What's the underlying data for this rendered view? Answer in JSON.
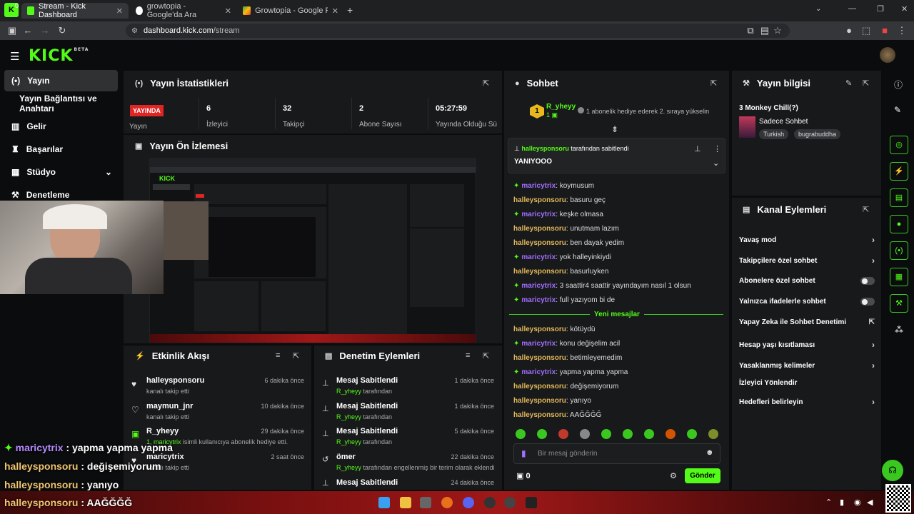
{
  "browser": {
    "tabs": [
      {
        "title": "Stream - Kick Dashboard",
        "active": true
      },
      {
        "title": "growtopia - Google'da Ara",
        "active": false
      },
      {
        "title": "Growtopia - Google Play'de Uy:",
        "active": false
      }
    ],
    "url_host": "dashboard.kick.com",
    "url_path": "/stream",
    "corner_badge": "0"
  },
  "logo": "KICK",
  "logo_beta": "BETA",
  "sidebar": {
    "items": [
      {
        "label": "Yayın",
        "icon": "broadcast-icon"
      },
      {
        "label": "Yayın Bağlantısı ve Anahtarı",
        "icon": ""
      },
      {
        "label": "Gelir",
        "icon": "chart-icon"
      },
      {
        "label": "Başarılar",
        "icon": "trophy-icon"
      },
      {
        "label": "Stüdyo",
        "icon": "studio-icon"
      },
      {
        "label": "Denetleme",
        "icon": "gavel-icon"
      }
    ]
  },
  "stats": {
    "title": "Yayın İstatistikleri",
    "live_badge": "YAYINDA",
    "status_label": "Yayın",
    "items": [
      {
        "value": "6",
        "label": "İzleyici"
      },
      {
        "value": "32",
        "label": "Takipçi"
      },
      {
        "value": "2",
        "label": "Abone Sayısı"
      },
      {
        "value": "05:27:59",
        "label": "Yayında Olduğu Sü"
      }
    ]
  },
  "preview": {
    "title": "Yayın Ön İzlemesi"
  },
  "activity": {
    "title": "Etkinlik Akışı",
    "rows": [
      {
        "name": "halleysponsoru",
        "sub": "kanalı takip etti",
        "time": "6 dakika önce"
      },
      {
        "name": "maymun_jnr",
        "sub": "kanalı takip etti",
        "time": "10 dakika önce"
      },
      {
        "name": "R_yheyy",
        "sub_user": "1, maricytrix",
        "sub": "isimli kullanıcıya abonelik hediye etti.",
        "time": "29 dakika önce"
      },
      {
        "name": "maricytrix",
        "sub": "kanalı takip etti",
        "time": "2 saat önce"
      }
    ]
  },
  "moderation": {
    "title": "Denetim Eylemleri",
    "rows": [
      {
        "name": "Mesaj Sabitlendi",
        "user": "R_yheyy",
        "sub": "tarafından",
        "time": "1 dakika önce"
      },
      {
        "name": "Mesaj Sabitlendi",
        "user": "R_yheyy",
        "sub": "tarafından",
        "time": "1 dakika önce"
      },
      {
        "name": "Mesaj Sabitlendi",
        "user": "R_yheyy",
        "sub": "tarafından",
        "time": "5 dakika önce"
      },
      {
        "name": "ömer",
        "user": "R_yheyy",
        "sub": "tarafından engellenmiş bir terim olarak eklendi",
        "time": "22 dakika önce"
      },
      {
        "name": "Mesaj Sabitlendi",
        "user": "",
        "sub": "",
        "time": "24 dakika önce"
      }
    ]
  },
  "chat": {
    "title": "Sohbet",
    "gifter_rank": "1",
    "gifter_name": "R_yheyy",
    "gifter_count": "1",
    "gift_notice": "1 abonelik hediye ederek 2. sıraya yükselin",
    "pinned_by_user": "halleysponsoru",
    "pinned_by_suffix": "tarafından sabitlendi",
    "pinned_text": "YANIYOOO",
    "new_messages": "Yeni mesajlar",
    "messages_before": [
      {
        "user": "maricytrix",
        "text": "koymusum",
        "type": "sub"
      },
      {
        "user": "halleysponsoru",
        "text": "basuru geç",
        "type": "norm"
      },
      {
        "user": "maricytrix",
        "text": "keşke olmasa",
        "type": "sub"
      },
      {
        "user": "halleysponsoru",
        "text": "unutmam lazım",
        "type": "norm"
      },
      {
        "user": "halleysponsoru",
        "text": "ben dayak yedim",
        "type": "norm"
      },
      {
        "user": "maricytrix",
        "text": "yok halleyinkiydi",
        "type": "sub"
      },
      {
        "user": "halleysponsoru",
        "text": "basurluyken",
        "type": "norm"
      },
      {
        "user": "maricytrix",
        "text": "3 saattir4 saattir yayındayım nasıl 1 olsun",
        "type": "sub"
      },
      {
        "user": "maricytrix",
        "text": "full yazıyom bi de",
        "type": "sub"
      }
    ],
    "messages_after": [
      {
        "user": "halleysponsoru",
        "text": "kötüydü",
        "type": "norm"
      },
      {
        "user": "maricytrix",
        "text": "konu değişelim acil",
        "type": "sub"
      },
      {
        "user": "halleysponsoru",
        "text": "betimleyemedim",
        "type": "norm"
      },
      {
        "user": "maricytrix",
        "text": "yapma yapma yapma",
        "type": "sub"
      },
      {
        "user": "halleysponsoru",
        "text": "değişemiyorum",
        "type": "norm"
      },
      {
        "user": "halleysponsoru",
        "text": "yanıyo",
        "type": "norm"
      },
      {
        "user": "halleysponsoru",
        "text": "AAĞĞĞĞ",
        "type": "norm"
      }
    ],
    "input_placeholder": "Bir mesaj gönderin",
    "points": "0",
    "send_label": "Gönder"
  },
  "stream_info": {
    "title": "Yayın bilgisi",
    "stream_title": "3 Monkey Chill(?)",
    "category": "Sadece Sohbet",
    "tags": [
      "Turkish",
      "bugrabuddha"
    ]
  },
  "channel_actions": {
    "title": "Kanal Eylemleri",
    "items": [
      {
        "label": "Yavaş mod",
        "control": "chevron"
      },
      {
        "label": "Takipçilere özel sohbet",
        "control": "chevron"
      },
      {
        "label": "Abonelere özel sohbet",
        "control": "toggle"
      },
      {
        "label": "Yalnızca ifadelerle sohbet",
        "control": "toggle"
      },
      {
        "label": "Yapay Zeka ile Sohbet Denetimi",
        "control": "external"
      },
      {
        "label": "Hesap yaşı kısıtlaması",
        "control": "chevron"
      },
      {
        "label": "Yasaklanmış kelimeler",
        "control": "chevron"
      },
      {
        "label": "İzleyici Yönlendir",
        "control": "none"
      },
      {
        "label": "Hedefleri belirleyin",
        "control": "chevron"
      }
    ]
  },
  "overlay_chat": [
    {
      "user": "maricytrix",
      "text": "yapma yapma yapma",
      "type": "sub"
    },
    {
      "user": "halleysponsoru",
      "text": "değişemiyorum",
      "type": "norm"
    },
    {
      "user": "halleysponsoru",
      "text": "yanıyo",
      "type": "norm"
    },
    {
      "user": "halleysponsoru",
      "text": "AAĞĞĞĞ",
      "type": "norm"
    }
  ],
  "colors": {
    "accent": "#53fc18",
    "live": "#e02525",
    "panel": "#18191b",
    "bg": "#0b0c0d"
  }
}
